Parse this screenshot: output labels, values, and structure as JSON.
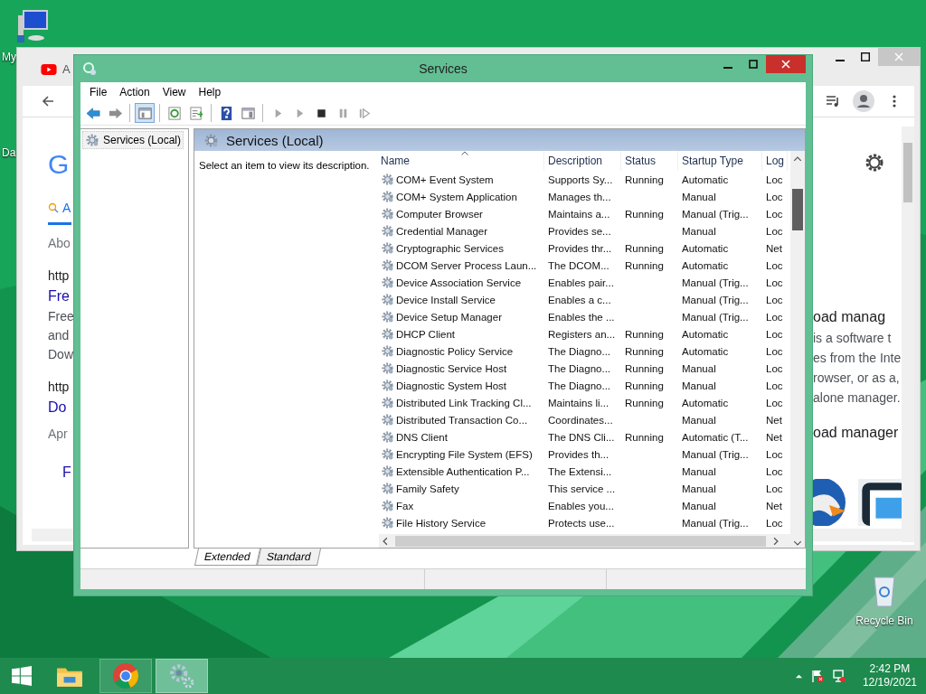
{
  "desktop": {
    "icons": [
      {
        "kind": "computer",
        "label": "My"
      },
      {
        "kind": "covered",
        "label": "Da"
      },
      {
        "kind": "recycle",
        "label": "Recycle Bin"
      }
    ]
  },
  "browser": {
    "tab_title": "A",
    "left_texts": [
      {
        "kind": "logo",
        "text": "G"
      },
      {
        "kind": "tab",
        "text": "A"
      },
      {
        "kind": "meta",
        "text": "Abo"
      },
      {
        "kind": "url",
        "text": "http"
      },
      {
        "kind": "title",
        "text": "Fre"
      },
      {
        "kind": "line",
        "text": "Free"
      },
      {
        "kind": "line",
        "text": "and"
      },
      {
        "kind": "line",
        "text": "Dow"
      },
      {
        "kind": "url",
        "text": "http"
      },
      {
        "kind": "title",
        "text": "Do"
      },
      {
        "kind": "meta",
        "text": "Apr"
      },
      {
        "kind": "title",
        "text": "F"
      }
    ],
    "right_texts": [
      {
        "kind": "heading",
        "text": "oad manag"
      },
      {
        "kind": "line",
        "text": "is a software t"
      },
      {
        "kind": "line",
        "text": "es from the Inte"
      },
      {
        "kind": "line",
        "text": "rowser, or as a,"
      },
      {
        "kind": "line",
        "text": "alone manager."
      },
      {
        "kind": "heading",
        "text": "oad manager"
      }
    ]
  },
  "services_window": {
    "title": "Services",
    "menu": [
      "File",
      "Action",
      "View",
      "Help"
    ],
    "toolbar": [
      {
        "kind": "back",
        "disabled": false,
        "pressed": false
      },
      {
        "kind": "forward",
        "disabled": true,
        "pressed": false
      },
      {
        "kind": "tree",
        "pressed": true
      },
      {
        "kind": "refresh",
        "pressed": false
      },
      {
        "kind": "export",
        "pressed": false
      },
      {
        "kind": "help",
        "pressed": false
      },
      {
        "kind": "properties",
        "pressed": false
      },
      {
        "kind": "start",
        "disabled": true,
        "pressed": false
      },
      {
        "kind": "start",
        "disabled": true,
        "pressed": false
      },
      {
        "kind": "stop",
        "disabled": false,
        "pressed": false
      },
      {
        "kind": "pause",
        "disabled": true,
        "pressed": false
      },
      {
        "kind": "resume",
        "disabled": true,
        "pressed": false
      }
    ],
    "tree": [
      {
        "label": "Services (Local)",
        "selected": true
      }
    ],
    "pane_title": "Services (Local)",
    "description": "Select an item to view its description.",
    "columns": [
      {
        "label": "Name",
        "sorted": true
      },
      {
        "label": "Description",
        "sorted": false
      },
      {
        "label": "Status",
        "sorted": false
      },
      {
        "label": "Startup Type",
        "sorted": false
      },
      {
        "label": "Log",
        "sorted": false
      }
    ],
    "rows": [
      {
        "name": "COM+ Event System",
        "description": "Supports Sy...",
        "status": "Running",
        "startup_type": "Automatic",
        "log_on_as": "Loc"
      },
      {
        "name": "COM+ System Application",
        "description": "Manages th...",
        "startup_type": "Manual",
        "log_on_as": "Loc"
      },
      {
        "name": "Computer Browser",
        "description": "Maintains a...",
        "status": "Running",
        "startup_type": "Manual (Trig...",
        "log_on_as": "Loc"
      },
      {
        "name": "Credential Manager",
        "description": "Provides se...",
        "startup_type": "Manual",
        "log_on_as": "Loc"
      },
      {
        "name": "Cryptographic Services",
        "description": "Provides thr...",
        "status": "Running",
        "startup_type": "Automatic",
        "log_on_as": "Net"
      },
      {
        "name": "DCOM Server Process Laun...",
        "description": "The DCOM...",
        "status": "Running",
        "startup_type": "Automatic",
        "log_on_as": "Loc"
      },
      {
        "name": "Device Association Service",
        "description": "Enables pair...",
        "startup_type": "Manual (Trig...",
        "log_on_as": "Loc"
      },
      {
        "name": "Device Install Service",
        "description": "Enables a c...",
        "startup_type": "Manual (Trig...",
        "log_on_as": "Loc"
      },
      {
        "name": "Device Setup Manager",
        "description": "Enables the ...",
        "startup_type": "Manual (Trig...",
        "log_on_as": "Loc"
      },
      {
        "name": "DHCP Client",
        "description": "Registers an...",
        "status": "Running",
        "startup_type": "Automatic",
        "log_on_as": "Loc"
      },
      {
        "name": "Diagnostic Policy Service",
        "description": "The Diagno...",
        "status": "Running",
        "startup_type": "Automatic",
        "log_on_as": "Loc"
      },
      {
        "name": "Diagnostic Service Host",
        "description": "The Diagno...",
        "status": "Running",
        "startup_type": "Manual",
        "log_on_as": "Loc"
      },
      {
        "name": "Diagnostic System Host",
        "description": "The Diagno...",
        "status": "Running",
        "startup_type": "Manual",
        "log_on_as": "Loc"
      },
      {
        "name": "Distributed Link Tracking Cl...",
        "description": "Maintains li...",
        "status": "Running",
        "startup_type": "Automatic",
        "log_on_as": "Loc"
      },
      {
        "name": "Distributed Transaction Co...",
        "description": "Coordinates...",
        "startup_type": "Manual",
        "log_on_as": "Net"
      },
      {
        "name": "DNS Client",
        "description": "The DNS Cli...",
        "status": "Running",
        "startup_type": "Automatic (T...",
        "log_on_as": "Net"
      },
      {
        "name": "Encrypting File System (EFS)",
        "description": "Provides th...",
        "startup_type": "Manual (Trig...",
        "log_on_as": "Loc"
      },
      {
        "name": "Extensible Authentication P...",
        "description": "The Extensi...",
        "startup_type": "Manual",
        "log_on_as": "Loc"
      },
      {
        "name": "Family Safety",
        "description": "This service ...",
        "startup_type": "Manual",
        "log_on_as": "Loc"
      },
      {
        "name": "Fax",
        "description": "Enables you...",
        "startup_type": "Manual",
        "log_on_as": "Net"
      },
      {
        "name": "File History Service",
        "description": "Protects use...",
        "startup_type": "Manual (Trig...",
        "log_on_as": "Loc"
      }
    ],
    "view_tabs": [
      {
        "label": "Extended",
        "selected": true
      },
      {
        "label": "Standard",
        "selected": false
      }
    ]
  },
  "taskbar": {
    "apps": [
      {
        "kind": "explorer",
        "running": false,
        "selected": false
      },
      {
        "kind": "browser",
        "running": true,
        "selected": false
      },
      {
        "kind": "services",
        "running": true,
        "selected": true
      }
    ],
    "time": "2:42 PM",
    "date": "12/19/2021"
  }
}
